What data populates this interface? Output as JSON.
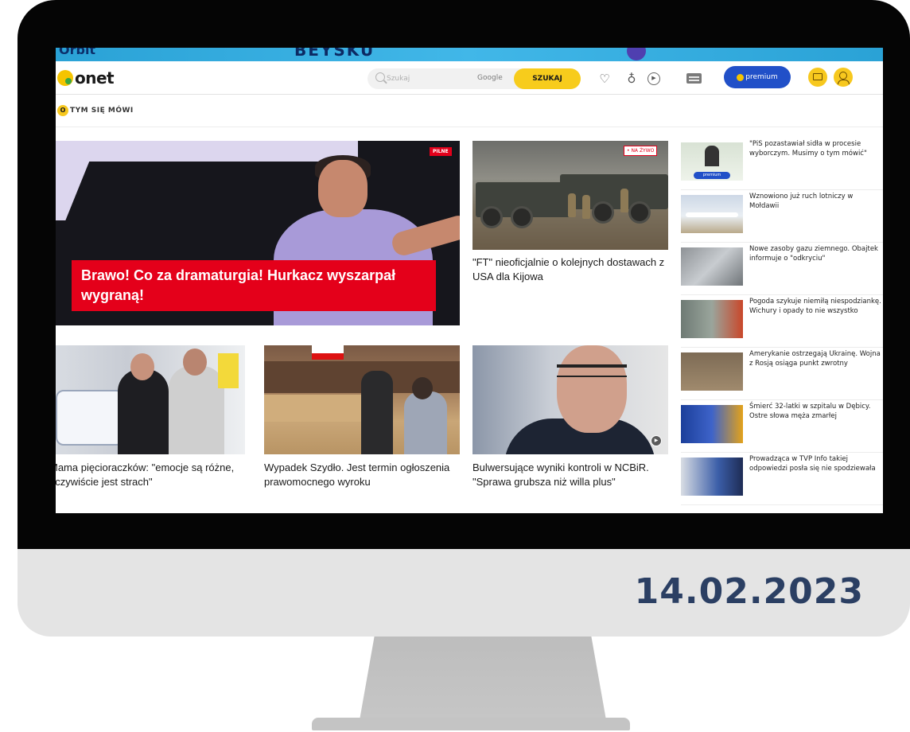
{
  "date_caption": "14.02.2023",
  "ad_banner": {
    "left_text": "Orbit",
    "center_text": "BEYSKU"
  },
  "header": {
    "logo_text": "onet",
    "search_placeholder": "Szukaj",
    "search_provider": "Google",
    "search_button": "SZUKAJ",
    "premium_label": "premium"
  },
  "trending": {
    "badge": "O",
    "label": "TYM SIĘ MÓWI"
  },
  "hero": {
    "tag": "PILNE",
    "title": "Brawo! Co za dramaturgia! Hurkacz wyszarpał wygraną!"
  },
  "center_top": {
    "tag": "• NA ŻYWO",
    "title": "\"FT\" nieoficjalnie o kolejnych dostawach z USA dla Kijowa"
  },
  "cards": [
    {
      "title": "Mama pięcioraczków: \"emocje są różne, oczywiście jest strach\""
    },
    {
      "title": "Wypadek Szydło. Jest termin ogłoszenia prawomocnego wyroku"
    },
    {
      "title": "Bulwersujące wyniki kontroli w NCBiR. \"Sprawa grubsza niż willa plus\""
    }
  ],
  "sidebar": {
    "premium_badge": "premium",
    "items": [
      {
        "title": "\"PiS pozastawiał sidła w procesie wyborczym. Musimy o tym mówić\""
      },
      {
        "title": "Wznowiono już ruch lotniczy w Mołdawii"
      },
      {
        "title": "Nowe zasoby gazu ziemnego. Obajtek informuje o \"odkryciu\""
      },
      {
        "title": "Pogoda szykuje niemiłą niespodziankę. Wichury i opady to nie wszystko"
      },
      {
        "title": "Amerykanie ostrzegają Ukrainę. Wojna z Rosją osiąga punkt zwrotny"
      },
      {
        "title": "Śmierć 32-latki w szpitalu w Dębicy. Ostre słowa męża zmarłej"
      },
      {
        "title": "Prowadząca w TVP Info takiej odpowiedzi posła się nie spodziewała"
      }
    ]
  },
  "colors": {
    "accent_yellow": "#f7c81e",
    "brand_red": "#e4001a",
    "premium_blue": "#2150c8",
    "date_navy": "#2b3f63"
  }
}
